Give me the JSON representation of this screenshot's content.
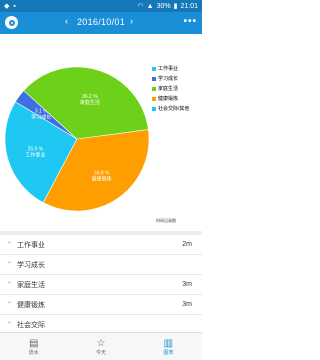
{
  "status": {
    "time": "21:01",
    "battery": "30%"
  },
  "header": {
    "date": "2016/10/01",
    "prev": "‹",
    "next": "›",
    "menu": "•••"
  },
  "chart_data": {
    "type": "pie",
    "slices": [
      {
        "label": "工作事业",
        "value": 25.9,
        "text": "25.9 %",
        "color": "#1ec8f2"
      },
      {
        "label": "学习成长",
        "value": 3.1,
        "text": "3.1 %",
        "color": "#3d6fe0"
      },
      {
        "label": "家庭生活",
        "value": 36.2,
        "text": "36.2 %",
        "color": "#6dd11a"
      },
      {
        "label": "健康锻炼",
        "value": 34.9,
        "text": "34.9 %",
        "color": "#ff9e00"
      },
      {
        "label": "社会交际",
        "value": 0,
        "text": "",
        "color": "#e8e03a"
      }
    ],
    "legend": [
      "工作事业",
      "学习成长",
      "家庭生活",
      "健康锻炼",
      "社会交际/其他"
    ],
    "legend_colors": [
      "#1ec8f2",
      "#3d6fe0",
      "#6dd11a",
      "#ff9e00",
      "#1ec8f2"
    ],
    "footnote": "时间记录图"
  },
  "list": [
    {
      "label": "工作事业",
      "value": "2m"
    },
    {
      "label": "学习成长",
      "value": ""
    },
    {
      "label": "家庭生活",
      "value": "3m"
    },
    {
      "label": "健康锻炼",
      "value": "3m"
    },
    {
      "label": "社会交际",
      "value": ""
    }
  ],
  "nav": [
    {
      "label": "流水",
      "icon": "▤"
    },
    {
      "label": "今天",
      "icon": "☆"
    },
    {
      "label": "图表",
      "icon": "▥"
    }
  ]
}
